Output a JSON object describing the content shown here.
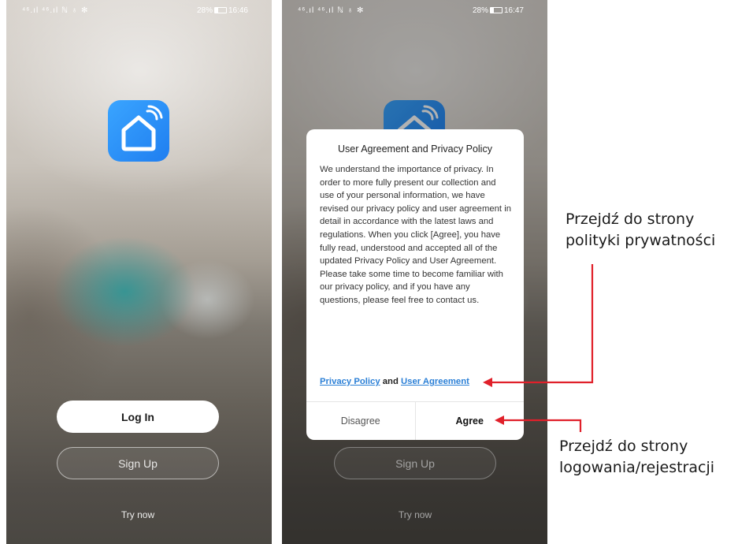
{
  "left_screen": {
    "statusbar": {
      "signal": "⁴⁶.ıl ⁴⁶.ıl ℕ ♁ ✻",
      "battery": "28%",
      "time": "16:46"
    },
    "login_label": "Log In",
    "signup_label": "Sign Up",
    "try_now_label": "Try now"
  },
  "right_screen": {
    "statusbar": {
      "signal": "⁴⁶.ıl ⁴⁶.ıl ℕ ♁ ✻",
      "battery": "28%",
      "time": "16:47"
    },
    "signup_label": "Sign Up",
    "try_now_label": "Try now",
    "dialog": {
      "title": "User Agreement and Privacy Policy",
      "body": "We understand the importance of privacy. In order to more fully present our collection and use of your personal information, we have revised our privacy policy and user agreement in detail in accordance with the latest laws and regulations. When you click [Agree], you have fully read, understood and accepted all of the updated Privacy Policy and User Agreement. Please take some time to become familiar with our privacy policy, and if you have any questions, please feel free to contact us.",
      "privacy_policy_link": "Privacy Policy",
      "and_text": "and",
      "user_agreement_link": "User Agreement",
      "disagree_label": "Disagree",
      "agree_label": "Agree"
    }
  },
  "annotations": {
    "privacy_line1": "Przejdź do strony",
    "privacy_line2": "polityki prywatności",
    "login_line1": "Przejdź do strony",
    "login_line2": "logowania/rejestracji"
  },
  "colors": {
    "app_icon": "#2b8ff5",
    "link": "#2a7fd6",
    "arrow": "#e0202a"
  },
  "icons": {
    "app_icon": "smart-home-wifi-icon",
    "battery": "battery-icon"
  }
}
